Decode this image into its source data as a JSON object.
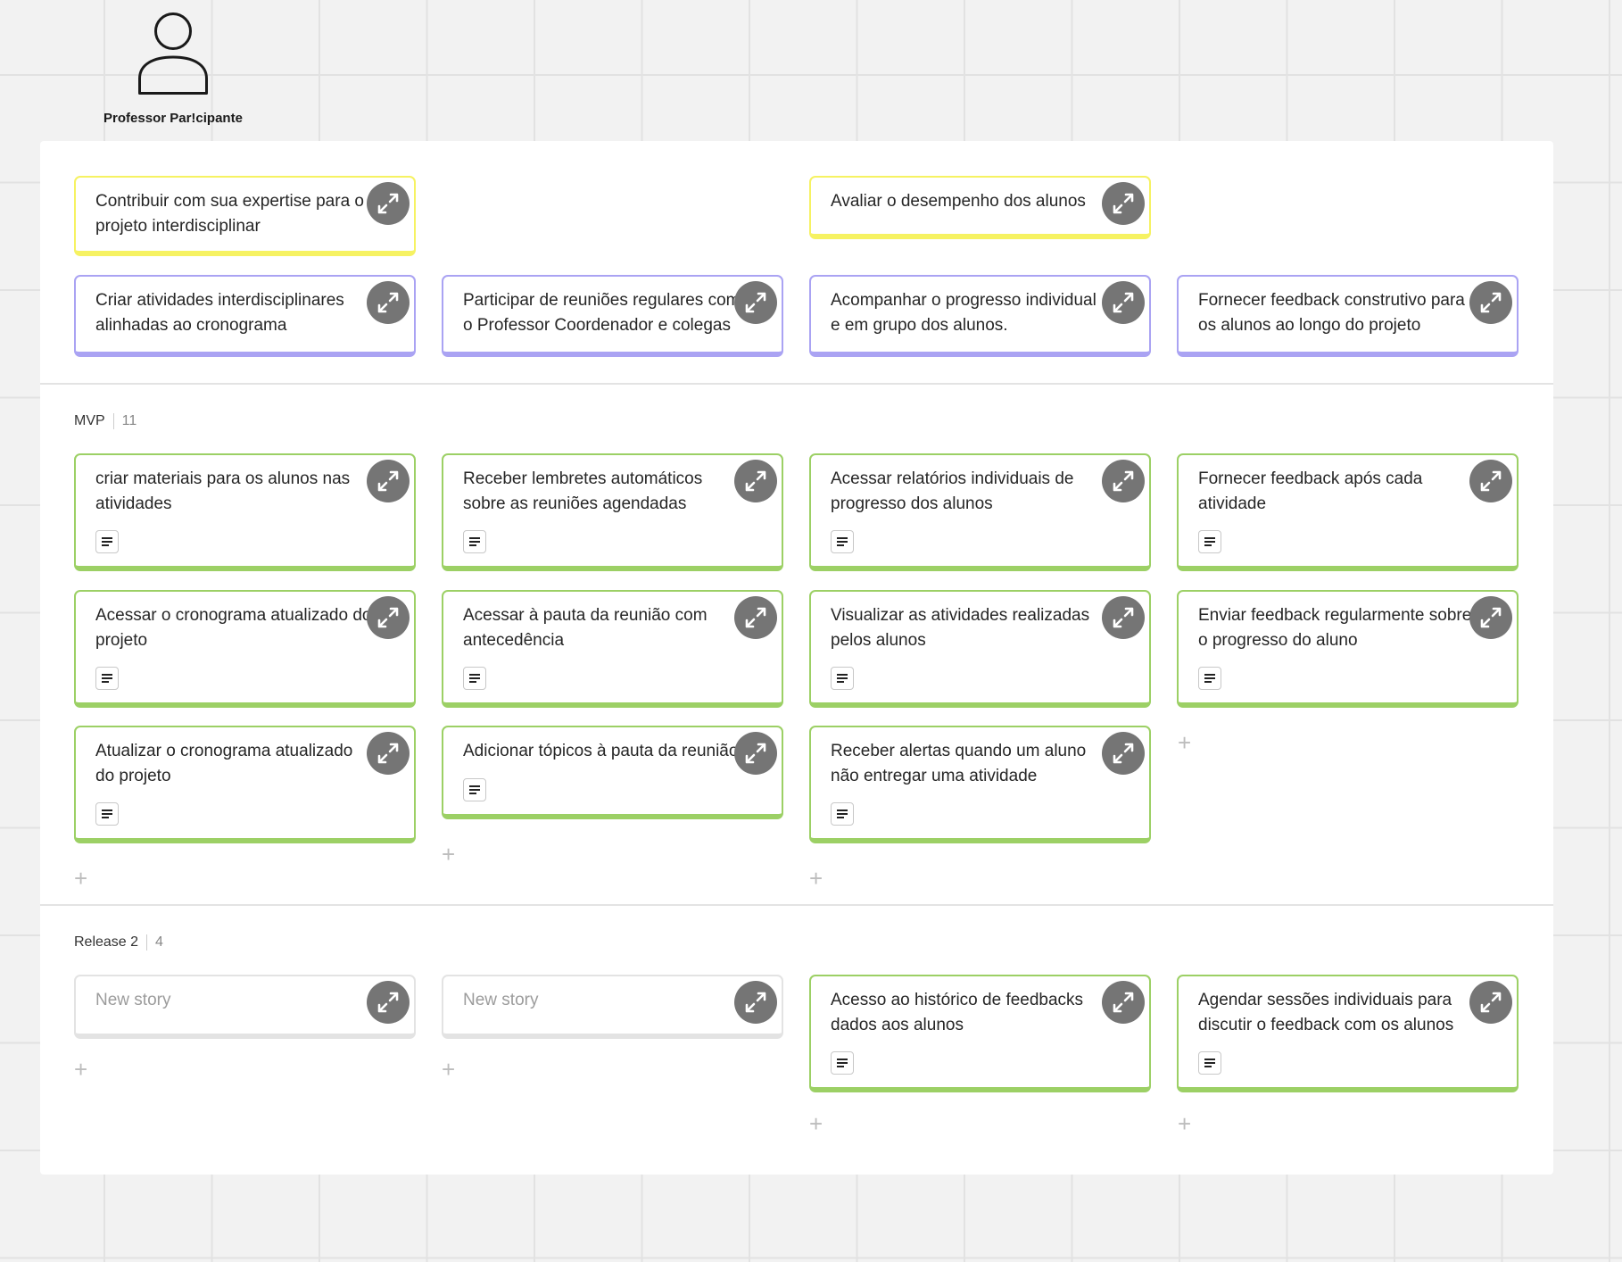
{
  "persona": {
    "name": "Professor Par!cipante",
    "icon": "person-icon"
  },
  "activities": [
    {
      "text": "Contribuir com sua expertise para o\nprojeto interdisciplinar"
    },
    {
      "text": "Avaliar o desempenho dos alunos"
    }
  ],
  "tasks": [
    {
      "text": "Criar atividades interdisciplinares\nalinhadas ao cronograma"
    },
    {
      "text": "Participar de reuniões regulares com\no Professor Coordenador e colegas"
    },
    {
      "text": "Acompanhar o progresso individual\ne em grupo dos alunos."
    },
    {
      "text": "Fornecer feedback construtivo para\nos alunos ao longo do projeto"
    }
  ],
  "mvp": {
    "label": "MVP",
    "count": "11",
    "cards": [
      {
        "text": "criar materiais para os alunos nas\natividades"
      },
      {
        "text": "Receber lembretes automáticos\nsobre as reuniões agendadas"
      },
      {
        "text": "Acessar relatórios individuais de\nprogresso dos alunos"
      },
      {
        "text": "Fornecer feedback após cada\natividade"
      },
      {
        "text": "Acessar o cronograma atualizado do\nprojeto"
      },
      {
        "text": "Acessar à pauta da reunião com\nantecedência"
      },
      {
        "text": "Visualizar as atividades realizadas\npelos alunos"
      },
      {
        "text": "Enviar feedback regularmente sobre\no progresso do aluno"
      },
      {
        "text": "Atualizar o cronograma atualizado\ndo projeto"
      },
      {
        "text": "Adicionar tópicos à pauta da reunião,"
      },
      {
        "text": "Receber alertas quando um aluno\nnão entregar uma atividade"
      }
    ]
  },
  "release2": {
    "label": "Release 2",
    "count": "4",
    "cards": [
      {
        "text": "New story"
      },
      {
        "text": "New story"
      },
      {
        "text": "Acesso ao histórico de feedbacks\ndados aos alunos"
      },
      {
        "text": "Agendar sessões individuais para\ndiscutir o feedback com os alunos"
      }
    ]
  },
  "colors": {
    "activity": "#f6f262",
    "task": "#aaa3f3",
    "story": "#9cd065",
    "placeholder": "#e3e3e3",
    "expand_button": "#757575"
  },
  "plus_glyph": "+"
}
